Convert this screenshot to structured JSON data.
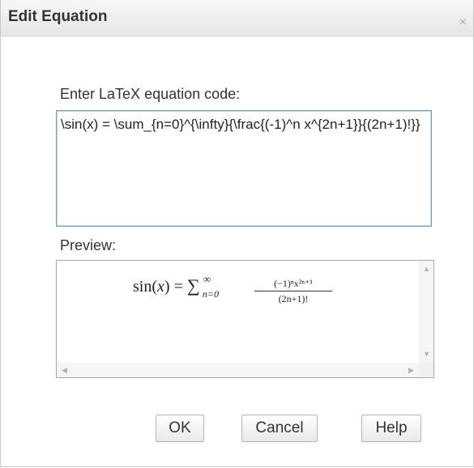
{
  "dialog": {
    "title": "Edit Equation",
    "close_glyph": "×"
  },
  "code": {
    "label": "Enter LaTeX equation code:",
    "value": "\\sin(x) = \\sum_{n=0}^{\\infty}{\\frac{(-1)^n x^{2n+1}}{(2n+1)!}}"
  },
  "preview": {
    "label": "Preview:",
    "formula": {
      "func": "sin",
      "open_paren": "(",
      "var": "x",
      "close_paren": ")",
      "equals": "=",
      "sum": "∑",
      "sum_upper": "∞",
      "sum_lower": "n=0",
      "numerator": "(−1)ⁿx²ⁿ⁺¹",
      "denominator": "(2n+1)!"
    },
    "scroll_up": "▲",
    "scroll_down": "▼",
    "scroll_left": "◀",
    "scroll_right": "▶"
  },
  "buttons": {
    "ok": "OK",
    "cancel": "Cancel",
    "help": "Help"
  }
}
